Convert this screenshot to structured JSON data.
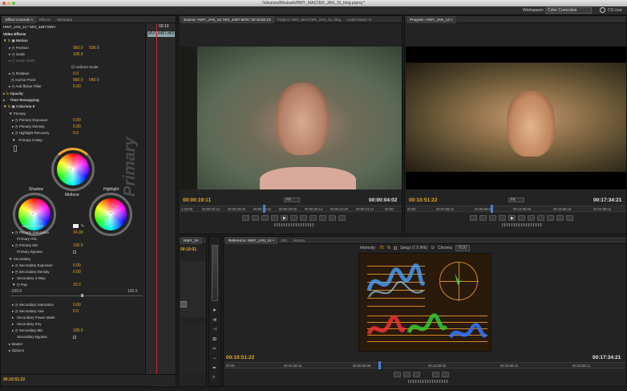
{
  "window_title": "/Volumes/Rhubarb/HWY_MASTER_JAN_15_blog.prproj *",
  "menubar": {
    "workspace_label": "Workspace:",
    "workspace_value": "Color Correction",
    "cs_live": "CS Live"
  },
  "effect_controls": {
    "tabs": [
      "Effect Controls ×",
      "Effects",
      "Metadata"
    ],
    "clip_name": "HWY_JAN_14 * MVI_4457.MOV",
    "timeline_tc": "00:10",
    "timeline_clip": "MVI_4457.MO",
    "section": "Video Effects",
    "motion": {
      "label": "Motion",
      "position_label": "Position",
      "position_x": "960.0",
      "position_y": "506.0",
      "scale_label": "Scale",
      "scale": "100.0",
      "scale_width_label": "Scale Width",
      "uniform_label": "Uniform Scale",
      "rotation_label": "Rotation",
      "rotation": "0.0",
      "anchor_label": "Anchor Point",
      "anchor_x": "960.0",
      "anchor_y": "540.0",
      "antiflicker_label": "Anti-flicker Filter",
      "antiflicker": "0.00"
    },
    "opacity_label": "Opacity",
    "time_remap_label": "Time Remapping",
    "colorista": {
      "label": "Colorista II",
      "primary_label": "Primary",
      "primary_exposure_label": "Primary Exposure",
      "primary_exposure": "0.00",
      "primary_density_label": "Primary Density",
      "primary_density": "0.00",
      "highlight_recovery_label": "Highlight Recovery",
      "highlight_recovery": "0.0",
      "threeway_label": "Primary 3-Way",
      "shadow_label": "Shadow",
      "midtone_label": "Midtone",
      "highlight_label": "Highlight",
      "watermark": "Primary",
      "auto_balance_label": "Auto Balance",
      "primary_saturation_label": "Primary Saturation",
      "primary_saturation": "24.00",
      "primary_hsl_label": "Primary HSL",
      "primary_mix_label": "Primary Mix",
      "primary_mix": "100.0",
      "primary_bypass_label": "Primary Bypass",
      "secondary_label": "Secondary",
      "secondary_exposure_label": "Secondary Exposure",
      "secondary_exposure": "0.00",
      "secondary_density_label": "Secondary Density",
      "secondary_density": "0.00",
      "secondary_threeway_label": "Secondary 3-Way",
      "pop_label": "Pop",
      "pop": "15.0",
      "pop_min": "-100.0",
      "pop_max": "100.0",
      "secondary_saturation_label": "Secondary Saturation",
      "secondary_saturation": "0.00",
      "secondary_hue_label": "Secondary Hue",
      "secondary_hue": "0.0",
      "secondary_power_mask_label": "Secondary Power Mask",
      "secondary_key_label": "Secondary Key",
      "secondary_mix_label": "Secondary Mix",
      "secondary_mix": "100.0",
      "secondary_bypass_label": "Secondary Bypass",
      "master_label": "Master",
      "options_label": "Options"
    },
    "bottom_tc": "00:10:51:22"
  },
  "source": {
    "tabs": [
      "Source: HWY_JAN_14: MVI_4457.MOV: 00:10:50:10",
      "Project: HWY_MASTER_JAN_15_blog",
      "Audio Mixer: H"
    ],
    "tc_in": "00:00:19:11",
    "fit": "Fit",
    "tc_dur": "00:00:04:02",
    "ruler": [
      "1:18:00",
      "00:00:18:12",
      "00:00:19:00",
      "00:00:19:12",
      "00:00:20:00",
      "00:00:20:12",
      "00:00:21:00",
      "00:00:21:12",
      "00:00:"
    ]
  },
  "program": {
    "tab": "Program: HWY_JAN_14 ×",
    "tc_in": "00:10:51:22",
    "fit": "Fit",
    "tc_dur": "00:17:34:21",
    "ruler": [
      "00:00",
      "00:04:59:16",
      "00:09:59:09",
      "00:14:59:02",
      "00:19:58:19",
      "00:24:58:12"
    ]
  },
  "timeline": {
    "tab": "HWY_JA",
    "tc": "00:10:51"
  },
  "reference": {
    "tabs": [
      "Reference: HWY_JAN_14 ×",
      "Info",
      "History"
    ],
    "intensity_label": "Intensity:",
    "intensity": "75",
    "intensity_unit": "%",
    "setup_label": "Setup (7.5 IRE)",
    "chroma_label": "Chroma",
    "mode": "YUV",
    "tc_in": "00:10:51:22",
    "tc_dur": "00:17:34:21",
    "ruler": [
      "00:00",
      "00:04:59:16",
      "00:09:59:09",
      "00:14:59:02",
      "00:19:58:19",
      "00:24:58:12"
    ]
  },
  "colors": {
    "accent": "#e9a82c",
    "panel": "#232323",
    "bg": "#1e1e1e"
  }
}
